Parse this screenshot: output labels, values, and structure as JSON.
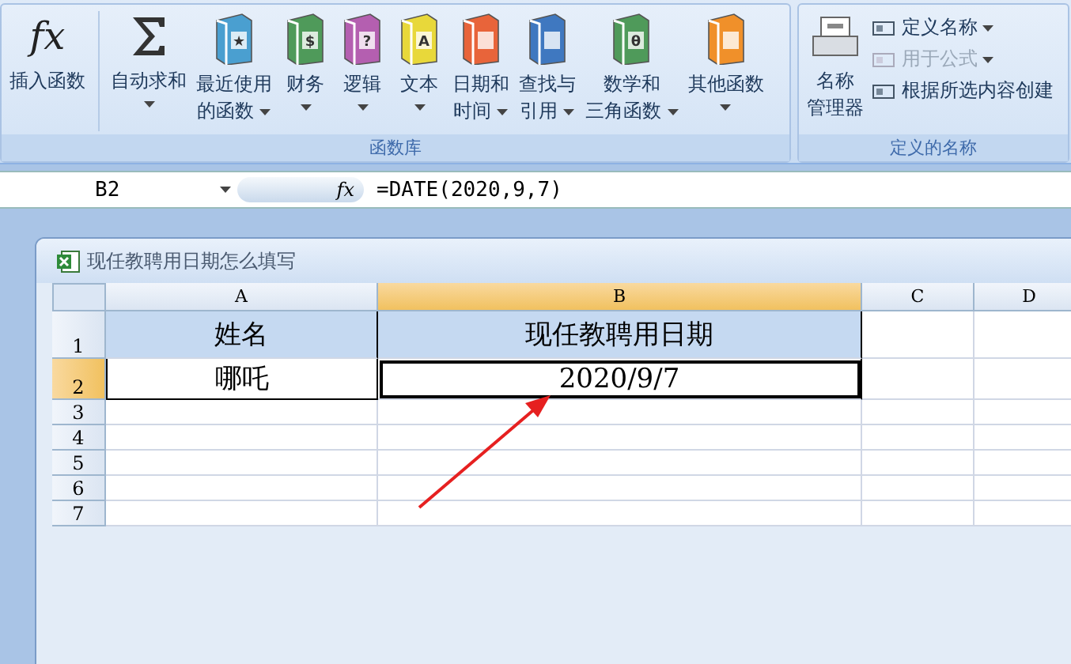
{
  "ribbon": {
    "groups": [
      {
        "label": "函数库",
        "buttons": [
          {
            "kind": "fx",
            "symbol": "fx",
            "lines": [
              "插入函数"
            ],
            "dropdown": false,
            "separator_after": true
          },
          {
            "kind": "sigma",
            "lines": [
              "自动求和"
            ],
            "dropdown": true,
            "separator_after": false
          },
          {
            "kind": "book",
            "color": "#4a9fd0",
            "symbol": "★",
            "lines": [
              "最近使用",
              "的函数"
            ],
            "dropdown": true,
            "separator_after": false
          },
          {
            "kind": "book",
            "color": "#4f9a5a",
            "symbol": "$",
            "lines": [
              "财务"
            ],
            "dropdown": true,
            "separator_after": false
          },
          {
            "kind": "book",
            "color": "#b45fb0",
            "symbol": "?",
            "lines": [
              "逻辑"
            ],
            "dropdown": true,
            "separator_after": false
          },
          {
            "kind": "book",
            "color": "#e8d83a",
            "symbol": "A",
            "lines": [
              "文本"
            ],
            "dropdown": true,
            "separator_after": false
          },
          {
            "kind": "book",
            "color": "#e8643a",
            "lines": [
              "日期和",
              "时间"
            ],
            "dropdown": true,
            "separator_after": false
          },
          {
            "kind": "book",
            "color": "#3f78c0",
            "lines": [
              "查找与",
              "引用"
            ],
            "dropdown": true,
            "separator_after": false
          },
          {
            "kind": "book",
            "color": "#4f9a5a",
            "symbol": "θ",
            "lines": [
              "数学和",
              "三角函数"
            ],
            "dropdown": true,
            "separator_after": false
          },
          {
            "kind": "book",
            "color": "#f0902a",
            "lines": [
              "其他函数"
            ],
            "dropdown": true,
            "separator_after": false
          }
        ]
      },
      {
        "label": "定义的名称",
        "buttons": [
          {
            "kind": "cabinet",
            "lines": [
              "名称",
              "管理器"
            ],
            "dropdown": false,
            "separator_after": false
          }
        ],
        "small_buttons": [
          {
            "label": "定义名称",
            "dropdown": true,
            "disabled": false
          },
          {
            "label": "用于公式",
            "dropdown": true,
            "disabled": true
          },
          {
            "label": "根据所选内容创建",
            "dropdown": false,
            "disabled": false
          }
        ]
      }
    ]
  },
  "formula_bar": {
    "name_box": "B2",
    "function_symbol": "fx",
    "formula": "=DATE(2020,9,7)"
  },
  "workbook": {
    "title": "现任教聘用日期怎么填写",
    "columns": [
      {
        "label": "A",
        "selected": false
      },
      {
        "label": "B",
        "selected": true
      },
      {
        "label": "C",
        "selected": false
      },
      {
        "label": "D",
        "selected": false
      }
    ],
    "rows": [
      {
        "number": "1",
        "selected": false,
        "kind": "header",
        "cells": [
          "姓名",
          "现任教聘用日期"
        ]
      },
      {
        "number": "2",
        "selected": true,
        "kind": "data",
        "cells": [
          "哪吒",
          "2020/9/7"
        ]
      },
      {
        "number": "3",
        "selected": false,
        "kind": "empty"
      },
      {
        "number": "4",
        "selected": false,
        "kind": "empty"
      },
      {
        "number": "5",
        "selected": false,
        "kind": "empty"
      },
      {
        "number": "6",
        "selected": false,
        "kind": "empty"
      },
      {
        "number": "7",
        "selected": false,
        "kind": "empty"
      }
    ]
  }
}
